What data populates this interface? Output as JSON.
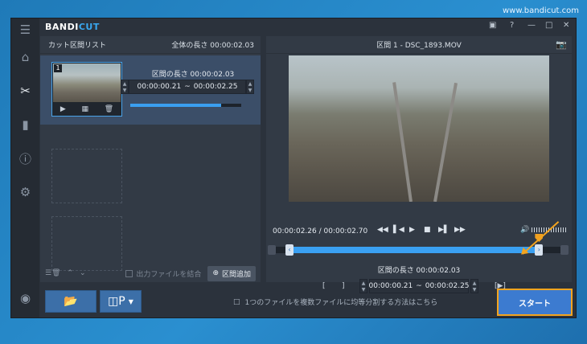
{
  "watermark": "www.bandicut.com",
  "app": {
    "logo_part1": "BANDI",
    "logo_part2": "CUT"
  },
  "window_controls": [
    "▭",
    "?",
    "—",
    "□",
    "✕"
  ],
  "sidebar": {
    "items": [
      "menu",
      "home",
      "cut",
      "film",
      "info",
      "settings",
      "record"
    ]
  },
  "left_panel": {
    "title": "カット区間リスト",
    "total_length": "全体の長さ 00:00:02.03",
    "clip": {
      "index": "1",
      "length_label": "区間の長さ 00:00:02.03",
      "start": "00:00:00.21",
      "sep": "~",
      "end": "00:00:02.25",
      "progress": 0.82
    },
    "merge_label": "出力ファイルを結合",
    "add_section": "区間追加"
  },
  "right_panel": {
    "title": "区間 1 - DSC_1893.MOV",
    "time_display": "00:00:02.26 / 00:00:02.70",
    "section_length": "区間の長さ 00:00:02.03",
    "start_bracket": "[",
    "end_bracket": "]",
    "start": "00:00:00.21",
    "sep": "~",
    "end": "00:00:02.25",
    "play_section": "[▶]",
    "selection_start": 0.053,
    "selection_end": 0.92,
    "playhead": 0.92
  },
  "bottom": {
    "hint": "1つのファイルを複数ファイルに均等分割する方法はこちら",
    "start_button": "スタート"
  },
  "colors": {
    "accent": "#3aa0f2",
    "highlight": "#f3a41f",
    "panel": "#323a45"
  }
}
